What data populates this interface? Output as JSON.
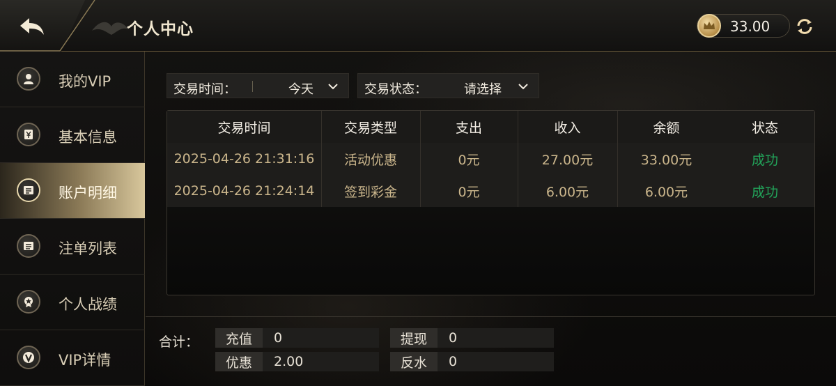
{
  "header": {
    "title": "个人中心",
    "balance": "33.00",
    "icons": {
      "back": "back-arrow-icon",
      "coin": "crown-coin-icon",
      "refresh": "refresh-icon"
    }
  },
  "sidebar": {
    "items": [
      {
        "label": "我的VIP",
        "icon": "user-icon",
        "active": false
      },
      {
        "label": "基本信息",
        "icon": "yuan-card-icon",
        "active": false
      },
      {
        "label": "账户明细",
        "icon": "ledger-icon",
        "active": true
      },
      {
        "label": "注单列表",
        "icon": "list-icon",
        "active": false
      },
      {
        "label": "个人战绩",
        "icon": "medal-icon",
        "active": false
      },
      {
        "label": "VIP详情",
        "icon": "vip-v-icon",
        "active": false
      }
    ]
  },
  "filters": {
    "time": {
      "label": "交易时间：",
      "value": "今天"
    },
    "status": {
      "label": "交易状态：",
      "value": "请选择"
    }
  },
  "table": {
    "headers": [
      "交易时间",
      "交易类型",
      "支出",
      "收入",
      "余额",
      "状态"
    ],
    "rows": [
      [
        "2025-04-26 21:31:16",
        "活动优惠",
        "0元",
        "27.00元",
        "33.00元",
        "成功"
      ],
      [
        "2025-04-26 21:24:14",
        "签到彩金",
        "0元",
        "6.00元",
        "6.00元",
        "成功"
      ]
    ]
  },
  "summary": {
    "label": "合计：",
    "recharge": {
      "key": "充值",
      "value": "0"
    },
    "withdraw": {
      "key": "提现",
      "value": "0"
    },
    "discount": {
      "key": "优惠",
      "value": "2.00"
    },
    "rebate": {
      "key": "反水",
      "value": "0"
    }
  },
  "colors": {
    "gold": "#cbb68c",
    "success": "#22a45a",
    "accent": "#d8c79c"
  }
}
